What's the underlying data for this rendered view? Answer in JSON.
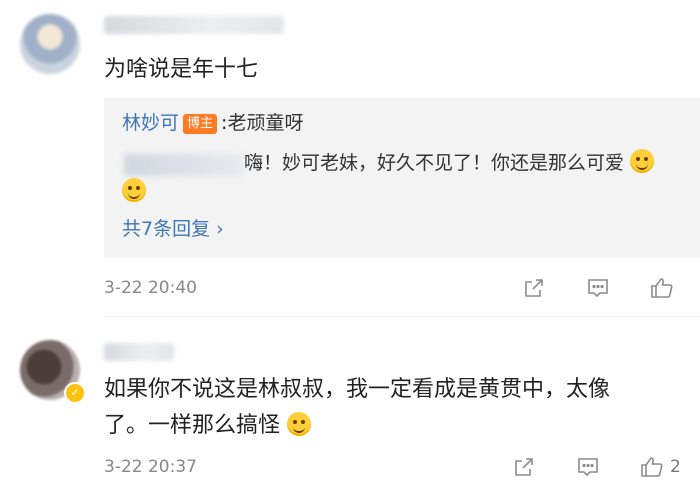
{
  "comments": [
    {
      "text": "为啥说是年十七",
      "reply_preview": {
        "author": "林妙可",
        "badge": "博主",
        "colon": ":",
        "text": "老顽童呀",
        "second_reply_text": "嗨！妙可老妹，好久不见了！你还是那么可爱",
        "more_label": "共7条回复 ›"
      },
      "time": "3-22 20:40",
      "like_count": ""
    },
    {
      "text_line1": "如果你不说这是林叔叔，我一定看成是黄贯中，太像",
      "text_line2": "了。一样那么搞怪",
      "time": "3-22 20:37",
      "like_count": "2"
    }
  ],
  "icons": {
    "share": "share-icon",
    "comment": "comment-icon",
    "like": "thumbs-up-icon",
    "verified": "verified-badge-icon"
  },
  "colors": {
    "link": "#3e76b8",
    "badge": "#ff7b23",
    "reply_bg": "#f3f3f3",
    "meta_text": "#888888"
  }
}
